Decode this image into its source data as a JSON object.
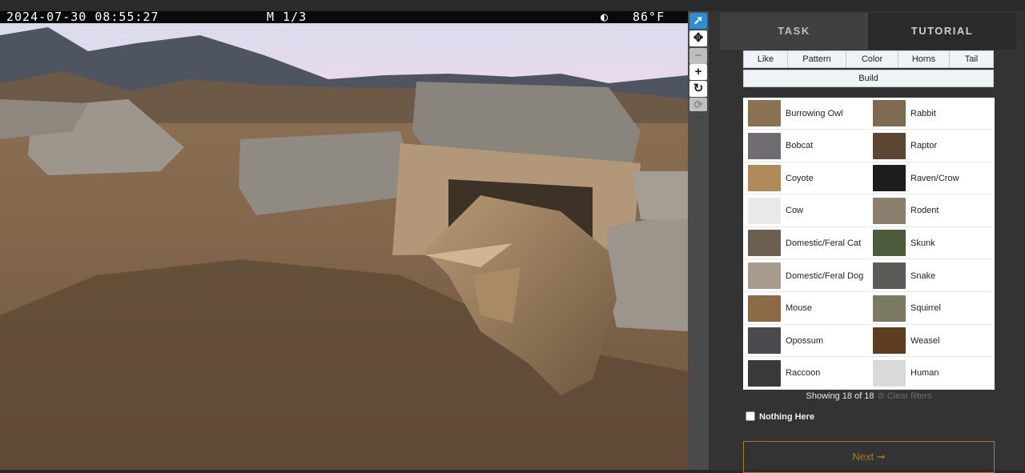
{
  "camera": {
    "timestamp": "2024-07-30 08:55:27",
    "mode": "M 1/3",
    "moon_icon": "moon-phase-icon",
    "temperature": "86°F"
  },
  "tools": [
    {
      "name": "pointer-icon",
      "glyph": "➚"
    },
    {
      "name": "move-icon",
      "glyph": "✥"
    },
    {
      "name": "zoom-out-icon",
      "glyph": "−"
    },
    {
      "name": "zoom-in-icon",
      "glyph": "+"
    },
    {
      "name": "rotate-icon",
      "glyph": "↻"
    },
    {
      "name": "reset-icon",
      "glyph": "⟳"
    }
  ],
  "tabs": {
    "task": "TASK",
    "tutorial": "TUTORIAL"
  },
  "filters": [
    "Like",
    "Pattern",
    "Color",
    "Horns",
    "Tail",
    "Build"
  ],
  "species": [
    {
      "label": "Burrowing Owl",
      "color": "#8a7152"
    },
    {
      "label": "Rabbit",
      "color": "#7d6a4f"
    },
    {
      "label": "Bobcat",
      "color": "#6f6d72"
    },
    {
      "label": "Raptor",
      "color": "#5b4634"
    },
    {
      "label": "Coyote",
      "color": "#b08a5a"
    },
    {
      "label": "Raven/Crow",
      "color": "#1d1d1d"
    },
    {
      "label": "Cow",
      "color": "#e9e9e9"
    },
    {
      "label": "Rodent",
      "color": "#8c7f6e"
    },
    {
      "label": "Domestic/Feral Cat",
      "color": "#6c5e4f"
    },
    {
      "label": "Skunk",
      "color": "#4e5a3c"
    },
    {
      "label": "Domestic/Feral Dog",
      "color": "#a79b8b"
    },
    {
      "label": "Snake",
      "color": "#5a5b56"
    },
    {
      "label": "Mouse",
      "color": "#8c6a46"
    },
    {
      "label": "Squirrel",
      "color": "#7c7a63"
    },
    {
      "label": "Opossum",
      "color": "#4a4a4c"
    },
    {
      "label": "Weasel",
      "color": "#5e3d23"
    },
    {
      "label": "Raccoon",
      "color": "#3a3a3a"
    },
    {
      "label": "Human",
      "color": "#d9d9d9"
    }
  ],
  "showing": {
    "text": "Showing 18 of 18",
    "clear": "⊘ Clear filters"
  },
  "nothing_here": "Nothing Here",
  "next": "Next ➞",
  "colors": {
    "accent": "#a47d1e",
    "active_tool": "#2e8bd6"
  }
}
